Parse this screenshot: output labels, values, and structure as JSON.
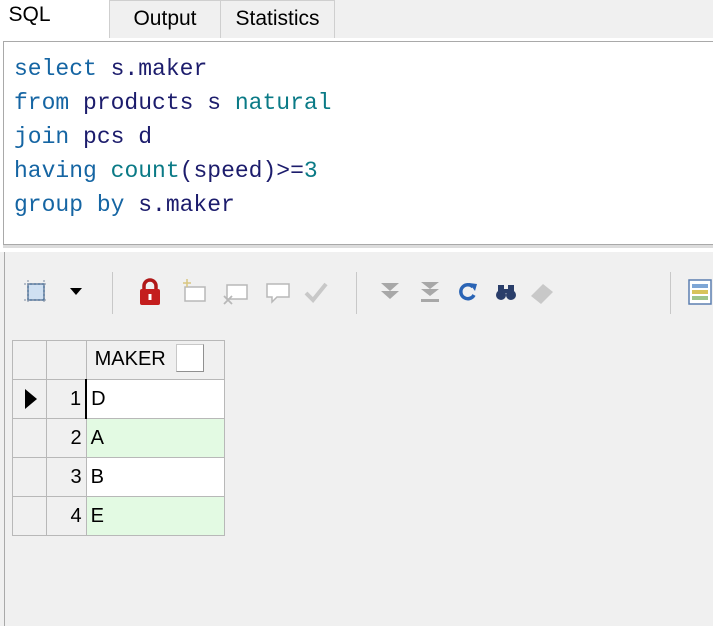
{
  "tabs": [
    {
      "label": "SQL"
    },
    {
      "label": "Output"
    },
    {
      "label": "Statistics"
    }
  ],
  "editor": {
    "lines": [
      [
        {
          "t": "select",
          "c": "kw"
        },
        {
          "t": " s.maker",
          "c": "id"
        }
      ],
      [
        {
          "t": "from",
          "c": "kw"
        },
        {
          "t": " products s ",
          "c": "id"
        },
        {
          "t": "natural",
          "c": "fn"
        }
      ],
      [
        {
          "t": "join",
          "c": "kw"
        },
        {
          "t": " pcs d",
          "c": "id"
        }
      ],
      [
        {
          "t": "having",
          "c": "kw"
        },
        {
          "t": " ",
          "c": "id"
        },
        {
          "t": "count",
          "c": "fn"
        },
        {
          "t": "(speed)",
          "c": "id"
        },
        {
          "t": ">=",
          "c": "op"
        },
        {
          "t": "3",
          "c": "fn"
        }
      ],
      [
        {
          "t": "group by",
          "c": "kw"
        },
        {
          "t": " s.maker",
          "c": "id"
        }
      ]
    ]
  },
  "toolbar": {
    "icons": [
      "grid-options-icon",
      "dropdown-arrow-icon",
      "lock-icon",
      "insert-record-icon",
      "delete-record-icon",
      "post-edit-icon",
      "fetch-next-icon",
      "fetch-last-icon",
      "refresh-icon",
      "find-icon",
      "clear-icon",
      "export-icon"
    ]
  },
  "grid": {
    "header": "MAKER",
    "rows": [
      {
        "num": "1",
        "value": "D",
        "current": true
      },
      {
        "num": "2",
        "value": "A",
        "current": false
      },
      {
        "num": "3",
        "value": "B",
        "current": false
      },
      {
        "num": "4",
        "value": "E",
        "current": false
      }
    ]
  },
  "colors": {
    "keyword": "#1565a3",
    "identifier": "#1c1c6c",
    "function": "#0a7a86",
    "alt_row": "#e3fae3"
  }
}
